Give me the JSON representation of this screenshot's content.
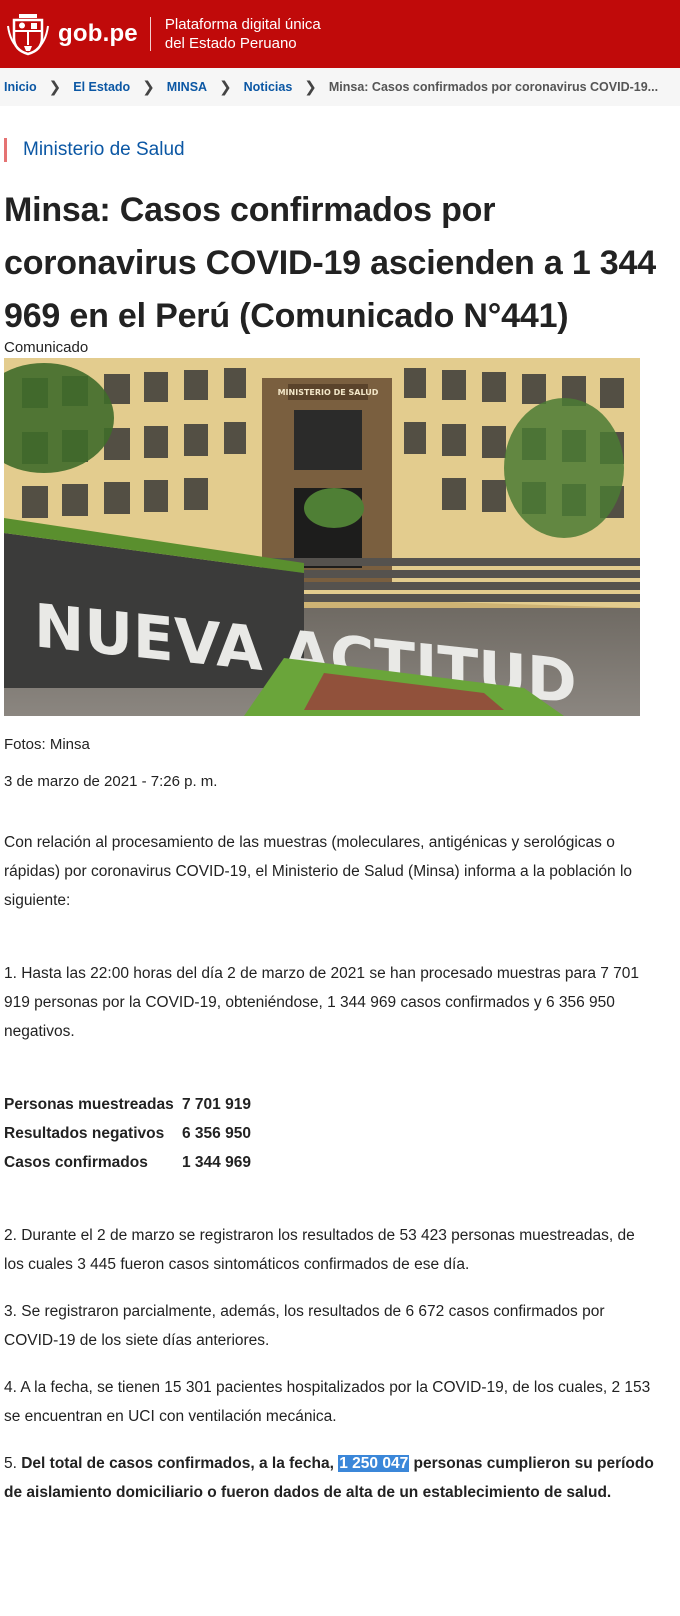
{
  "header": {
    "brand": "gob.pe",
    "tagline_line1": "Plataforma digital única",
    "tagline_line2": "del Estado Peruano",
    "bg_color": "#c00a0a"
  },
  "breadcrumb": {
    "items": [
      "Inicio",
      "El Estado",
      "MINSA",
      "Noticias"
    ],
    "current": "Minsa: Casos confirmados por coronavirus COVID-19..."
  },
  "article": {
    "ministry": "Ministerio de Salud",
    "title": "Minsa: Casos confirmados por coronavirus COVID-19 ascienden a 1 344 969 en el Perú (Comunicado N°441)",
    "category": "Comunicado",
    "image_sign_text": "MINISTERIO DE SALUD",
    "image_slogan": "NUEVA ACTITUD",
    "caption": "Fotos: Minsa",
    "date": "3 de marzo de 2021 - 7:26 p. m.",
    "intro": "Con relación al procesamiento de las muestras (moleculares, antigénicas y serológicas o rápidas) por coronavirus COVID-19, el Ministerio de Salud (Minsa) informa a la población lo siguiente:",
    "point1": "1. Hasta las 22:00 horas del día 2 de marzo de 2021 se han procesado muestras para 7 701 919 personas por la COVID-19, obteniéndose, 1 344 969 casos confirmados y 6 356 950 negativos.",
    "stats": [
      {
        "label": "Personas muestreadas",
        "value": "7 701 919"
      },
      {
        "label": "Resultados negativos",
        "value": "6 356 950"
      },
      {
        "label": "Casos confirmados",
        "value": "1 344 969"
      }
    ],
    "point2": "2. Durante el 2 de marzo se registraron los resultados de 53 423 personas muestreadas, de los cuales 3 445 fueron casos sintomáticos confirmados de ese día.",
    "point3": "3. Se registraron parcialmente, además, los resultados de 6 672 casos confirmados por COVID-19 de los siete días anteriores.",
    "point4": "4. A la fecha, se tienen 15 301 pacientes hospitalizados por la COVID-19, de los cuales, 2 153 se encuentran en UCI con ventilación mecánica.",
    "point5_num": "5. ",
    "point5_a": "Del total de casos confirmados, a la fecha, ",
    "point5_highlight": "1 250 047",
    "point5_b": " personas cumplieron su período de aislamiento domiciliario o fueron dados de alta de un establecimiento de salud."
  }
}
